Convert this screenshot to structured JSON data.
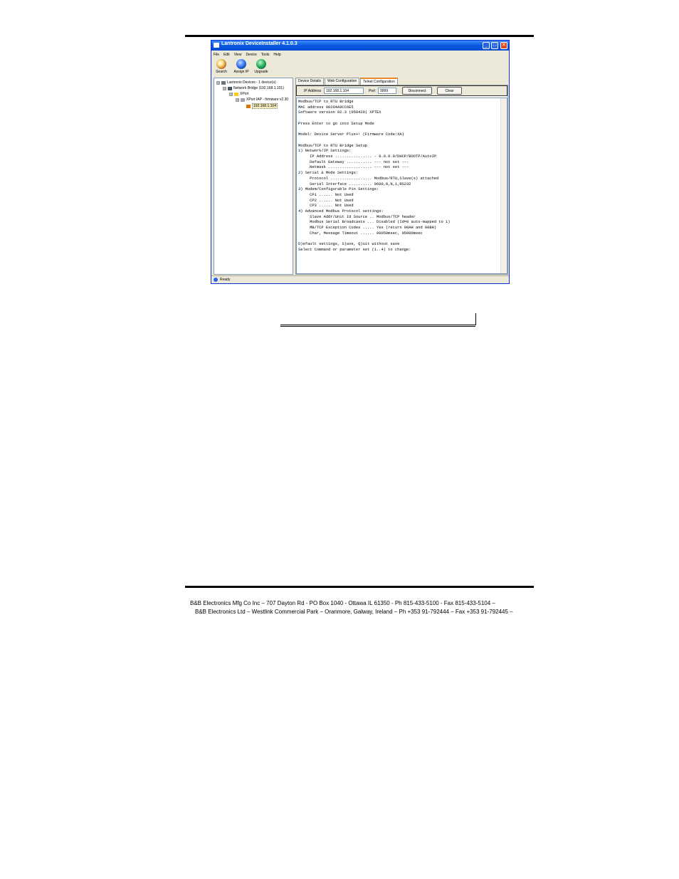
{
  "window": {
    "title": "Lantronix DeviceInstaller 4.1.0.3",
    "controls": {
      "minimize": "_",
      "maximize": "□",
      "close": "✕"
    },
    "menu": [
      "File",
      "Edit",
      "View",
      "Device",
      "Tools",
      "Help"
    ],
    "toolbar": [
      {
        "label": "Search",
        "icon": "search-icon"
      },
      {
        "label": "Assign IP",
        "icon": "assign-ip-icon"
      },
      {
        "label": "Upgrade",
        "icon": "upgrade-icon"
      }
    ],
    "tree": {
      "root": "Lantronix Devices - 1 device(s)",
      "network": "Network Bridge (192.168.1.101)",
      "type": "XPort",
      "firmware": "XPort IAP - firmware v2.30",
      "device": "192.168.1.104",
      "expander": "⊟"
    },
    "tabs": [
      "Device Details",
      "Web Configuration",
      "Telnet Configuration"
    ],
    "active_tab": "Telnet Configuration",
    "telnet": {
      "ip_label": "IP Address",
      "ip_value": "192.168.1.104",
      "port_label": "Port",
      "port_value": "9999",
      "disconnect_label": "Disconnect",
      "clear_label": "Clear"
    },
    "console_lines": [
      "Modbus/TCP to RTU Bridge",
      "MAC address 00204A9CC6E5",
      "Software version 02.3 (050420) XPTEX",
      "",
      "Press Enter to go into Setup Mode",
      "",
      "Model: Device Server Plus+! (Firmware Code:XA)",
      "",
      "Modbus/TCP to RTU Bridge Setup",
      "1) Network/IP Settings:",
      "     IP Address ................ - 0.0.0.0/DHCP/BOOTP/AutoIP",
      "     Default Gateway ........... --- not set ---",
      "     Netmask ................... --- not set ---",
      "2) Serial & Mode Settings:",
      "     Protocol .................. Modbus/RTU,Slave(s) attached",
      "     Serial Interface .......... 9600,8,N,1,RS232",
      "3) Modem/Configurable Pin Settings:",
      "     CP1 ...... Not Used",
      "     CP2 ...... Not Used",
      "     CP3 ...... Not Used",
      "4) Advanced Modbus Protocol settings:",
      "     Slave Addr/Unit Id Source .. Modbus/TCP header",
      "     Modbus Serial Broadcasts ... Disabled (Id=0 auto-mapped to 1)",
      "     MB/TCP Exception Codes ..... Yes (return 00AH and 00BH)",
      "     Char, Message Timeout ...... 00050msec, 05000msec",
      "",
      "D)efault settings, S)ave, Q)uit without save",
      "Select Command or parameter set (1..4) to change:"
    ],
    "status": "Ready"
  },
  "footer": {
    "line1": "B&B Electronics Mfg Co Inc – 707 Dayton Rd - PO Box 1040 - Ottawa IL 61350 - Ph 815-433-5100 - Fax 815-433-5104 –",
    "line2": "B&B Electronics Ltd – Westlink Commercial Park – Oranmore, Galway, Ireland – Ph +353 91-792444 – Fax +353 91-792445 –"
  }
}
